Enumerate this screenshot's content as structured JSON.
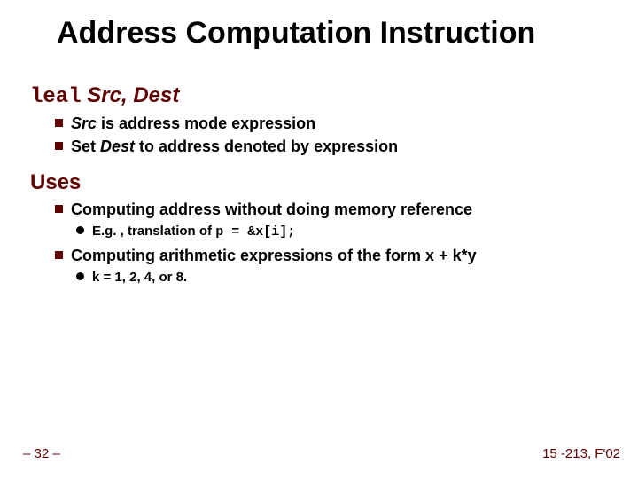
{
  "title": "Address Computation Instruction",
  "section1": {
    "heading_mono": "leal",
    "heading_args": "Src, Dest",
    "bullets": [
      {
        "pre": "",
        "italic": "Src",
        "post": " is address mode expression"
      },
      {
        "pre": "Set ",
        "italic": "Dest",
        "post": " to address denoted by expression"
      }
    ]
  },
  "section2": {
    "heading": "Uses",
    "items": [
      {
        "text": "Computing address without doing memory reference",
        "sub": {
          "pre": "E.g. , translation of ",
          "code": "p = &x[i];"
        }
      },
      {
        "text": "Computing arithmetic expressions of the form x + k*y",
        "sub": {
          "pre": "k = 1, 2, 4, or 8.",
          "code": ""
        }
      }
    ]
  },
  "footer": {
    "left": "– 32 –",
    "right": "15 -213, F'02"
  }
}
